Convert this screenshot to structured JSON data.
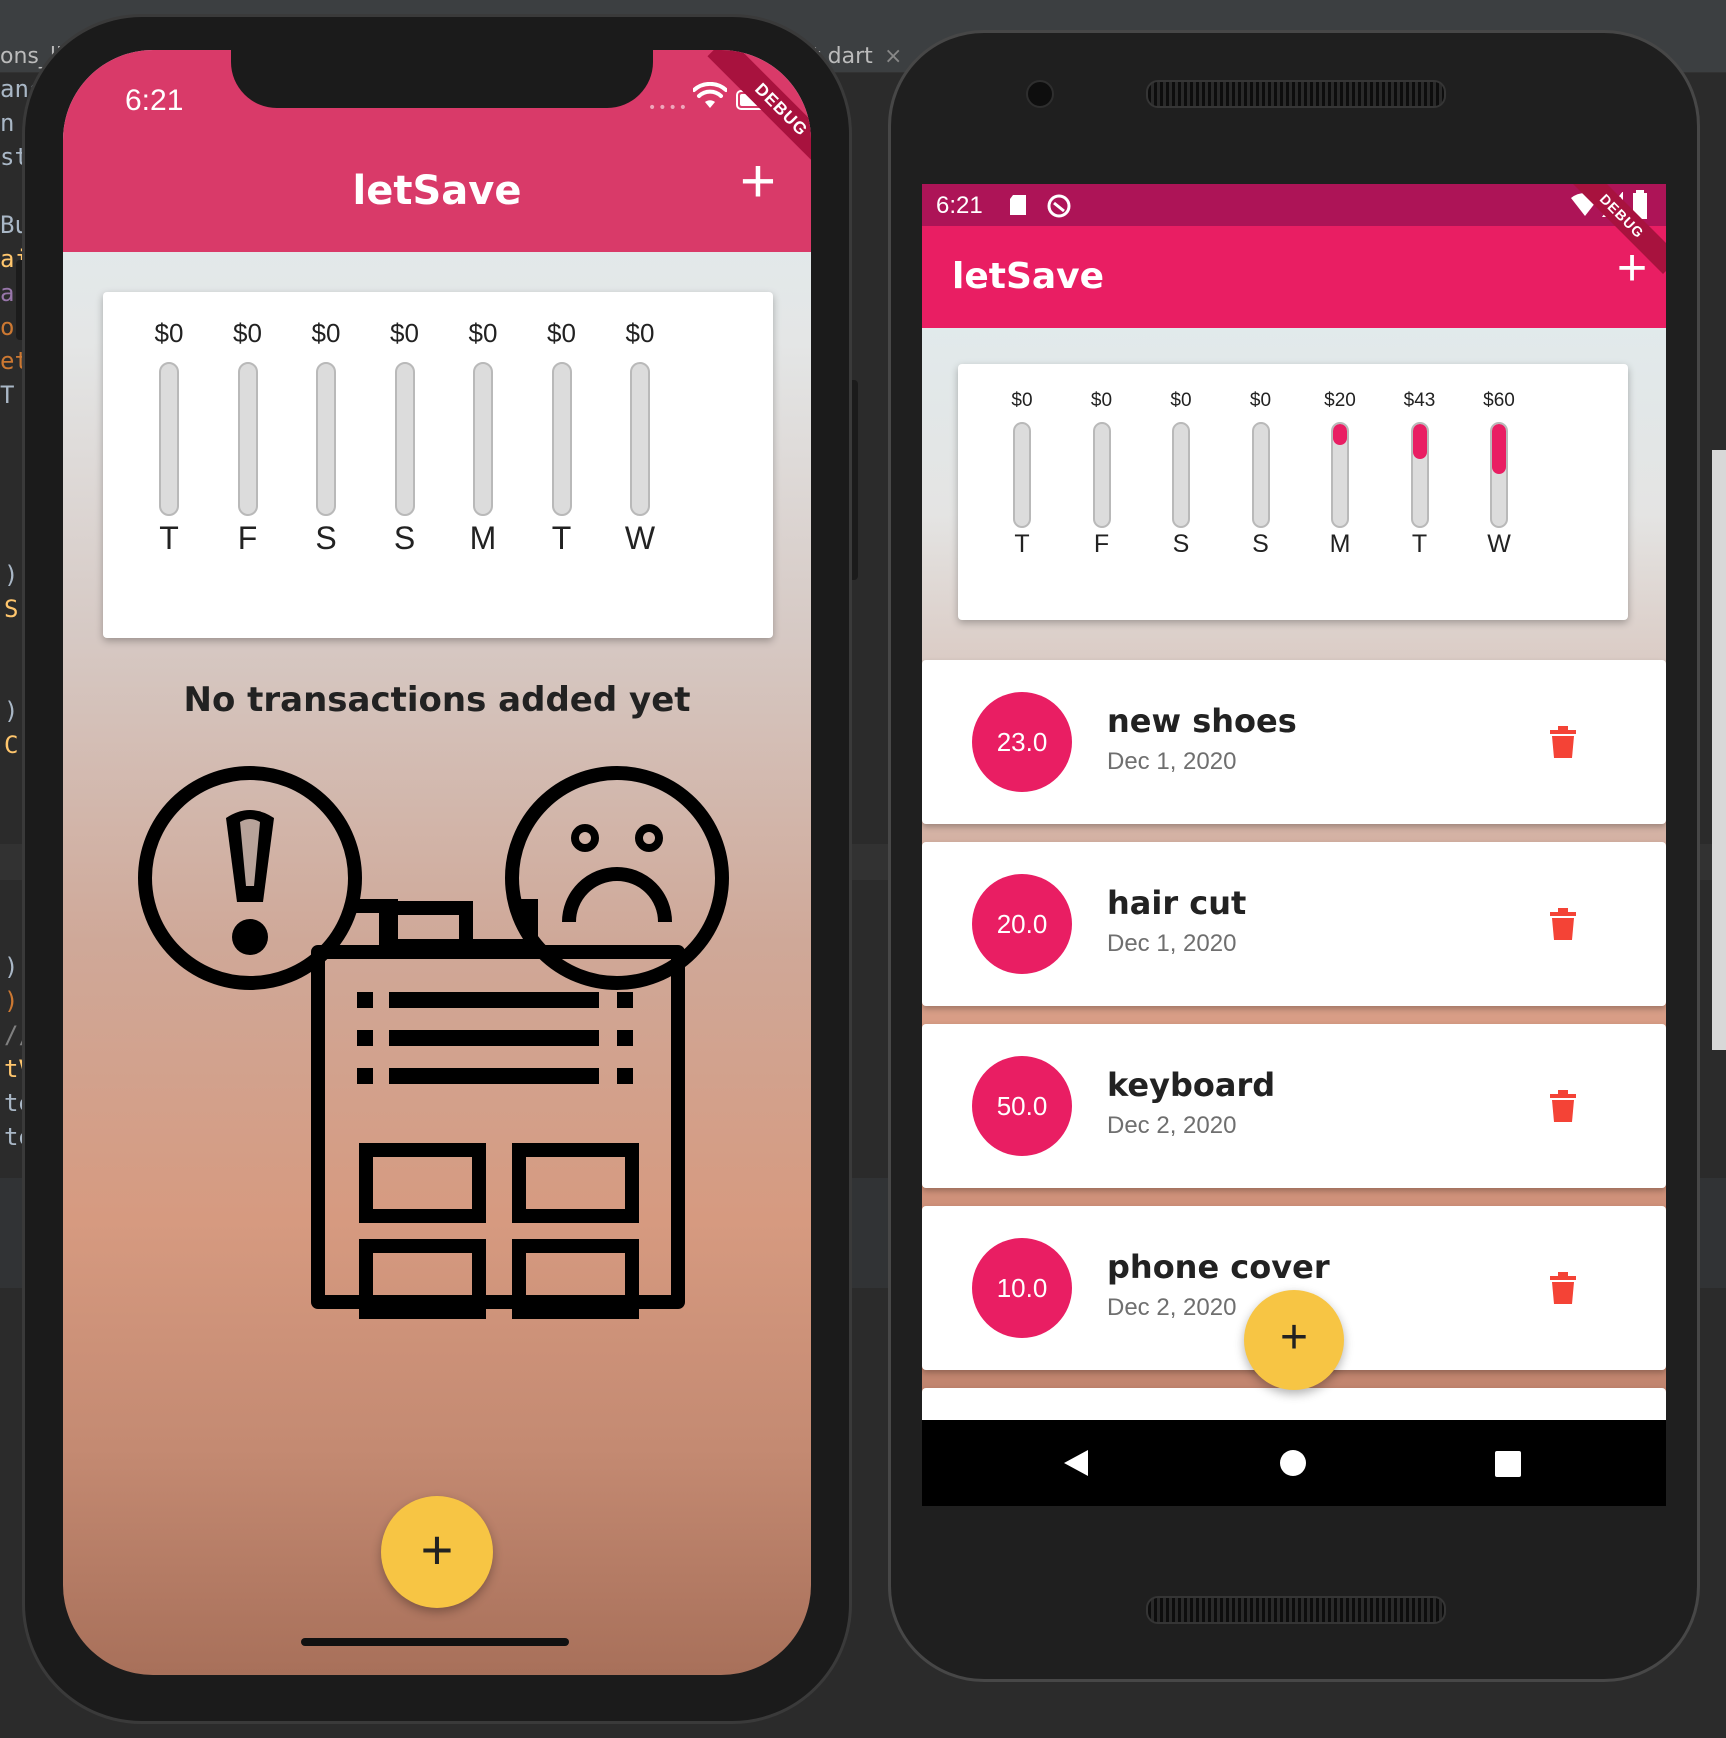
{
  "ide": {
    "tab_left": "ons_lis",
    "tab_right": "t.dart",
    "tab_close": "×",
    "code_fragments": [
      "ans",
      "n",
      "st",
      "Bu",
      "ai",
      "an",
      "ou",
      "et",
      "T",
      ")",
      "S",
      ")",
      "C",
      ")",
      ");",
      "//",
      "tV",
      "te",
      "te"
    ]
  },
  "iphone": {
    "status": {
      "time": "6:21",
      "dots": "••••"
    },
    "debug_label": "DEBUG",
    "app_title": "letSave",
    "add_icon": "+",
    "chart": [
      {
        "amount": "$0",
        "day": "T",
        "fill": 0
      },
      {
        "amount": "$0",
        "day": "F",
        "fill": 0
      },
      {
        "amount": "$0",
        "day": "S",
        "fill": 0
      },
      {
        "amount": "$0",
        "day": "S",
        "fill": 0
      },
      {
        "amount": "$0",
        "day": "M",
        "fill": 0
      },
      {
        "amount": "$0",
        "day": "T",
        "fill": 0
      },
      {
        "amount": "$0",
        "day": "W",
        "fill": 0
      }
    ],
    "empty_message": "No transactions added yet",
    "fab_icon": "+"
  },
  "android": {
    "status": {
      "time": "6:21"
    },
    "debug_label": "DEBUG",
    "app_title": "letSave",
    "add_icon": "+",
    "chart": [
      {
        "amount": "$0",
        "day": "T",
        "fill": 0
      },
      {
        "amount": "$0",
        "day": "F",
        "fill": 0
      },
      {
        "amount": "$0",
        "day": "S",
        "fill": 0
      },
      {
        "amount": "$0",
        "day": "S",
        "fill": 0
      },
      {
        "amount": "$20",
        "day": "M",
        "fill": 0.2
      },
      {
        "amount": "$43",
        "day": "T",
        "fill": 0.33
      },
      {
        "amount": "$60",
        "day": "W",
        "fill": 0.47
      }
    ],
    "transactions": [
      {
        "amount": "23.0",
        "title": "new shoes",
        "date": "Dec 1, 2020"
      },
      {
        "amount": "20.0",
        "title": "hair cut",
        "date": "Dec 1, 2020"
      },
      {
        "amount": "50.0",
        "title": "keyboard",
        "date": "Dec 2, 2020"
      },
      {
        "amount": "10.0",
        "title": "phone cover",
        "date": "Dec 2, 2020"
      }
    ],
    "fab_icon": "+"
  },
  "colors": {
    "ios_appbar": "#d93a69",
    "android_appbar": "#e91e63",
    "android_statusbar": "#ad1457",
    "fab": "#f7c544",
    "delete": "#f44336"
  }
}
